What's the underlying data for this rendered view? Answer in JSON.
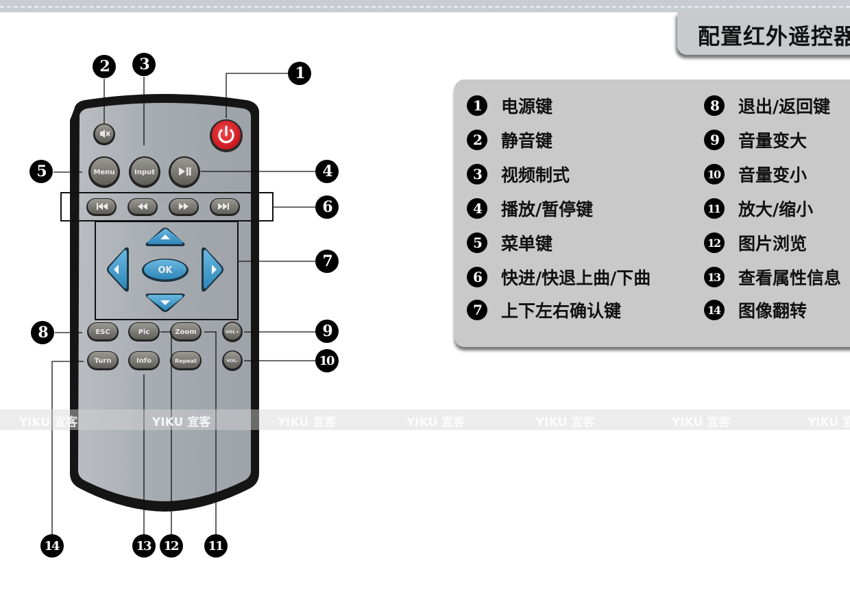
{
  "header": {
    "title": "配置红外遥控器"
  },
  "legend": {
    "items": [
      {
        "num": "1",
        "label": "电源键"
      },
      {
        "num": "2",
        "label": "静音键"
      },
      {
        "num": "3",
        "label": "视频制式"
      },
      {
        "num": "4",
        "label": "播放/暂停键"
      },
      {
        "num": "5",
        "label": "菜单键"
      },
      {
        "num": "6",
        "label": "快进/快退上曲/下曲"
      },
      {
        "num": "7",
        "label": "上下左右确认键"
      },
      {
        "num": "8",
        "label": "退出/返回键"
      },
      {
        "num": "9",
        "label": "音量变大"
      },
      {
        "num": "10",
        "label": "音量变小"
      },
      {
        "num": "11",
        "label": "放大/缩小"
      },
      {
        "num": "12",
        "label": "图片浏览"
      },
      {
        "num": "13",
        "label": "查看属性信息"
      },
      {
        "num": "14",
        "label": "图像翻转"
      }
    ]
  },
  "remote": {
    "buttons": {
      "mute": "mute-icon",
      "power": "power-icon",
      "menu": "Menu",
      "input": "Input",
      "play_pause": "▶II",
      "prev": "I◀◀",
      "rewind": "◀◀",
      "forward": "▶▶",
      "next": "▶▶I",
      "ok": "OK",
      "esc": "ESC",
      "pic": "Pic",
      "zoom": "Zoom",
      "vol_up": "VOL+",
      "turn": "Turn",
      "info": "Info",
      "repeat": "Repeat",
      "vol_down": "VOL-"
    },
    "colors": {
      "power": "#e3262e",
      "nav": "#3f9bc9",
      "body": "#a6abb1",
      "frame": "#151515",
      "gray_button": "#7b7a74"
    }
  },
  "callouts": {
    "c1": "1",
    "c2": "2",
    "c3": "3",
    "c4": "4",
    "c5": "5",
    "c6": "6",
    "c7": "7",
    "c8": "8",
    "c9": "9",
    "c10": "10",
    "c11": "11",
    "c12": "12",
    "c13": "13",
    "c14": "14"
  },
  "watermark": {
    "text": "YIKU 宜客"
  }
}
